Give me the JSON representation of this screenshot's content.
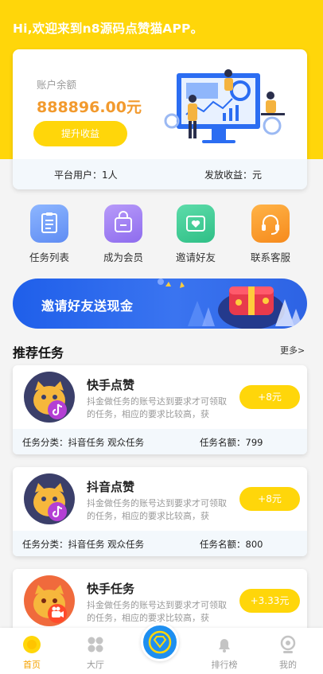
{
  "header": {
    "greeting": "Hi,欢迎来到n8源码点赞猫APP。"
  },
  "balance": {
    "label": "账户余额",
    "value": "888896.00元",
    "withdraw_label": "提升收益",
    "users_text": "平台用户：1人",
    "payout_text": "发放收益：元"
  },
  "menu": {
    "items": [
      {
        "label": "任务列表",
        "icon": "clipboard-icon",
        "color": "#6f98f7"
      },
      {
        "label": "成为会员",
        "icon": "member-bag-icon",
        "color": "#a07cf1"
      },
      {
        "label": "邀请好友",
        "icon": "envelope-heart-icon",
        "color": "#3dc895"
      },
      {
        "label": "联系客服",
        "icon": "headset-icon",
        "color": "#fb9a2a"
      }
    ]
  },
  "banner": {
    "text": "邀请好友送现金"
  },
  "recommend": {
    "title": "推荐任务",
    "more_label": "更多>"
  },
  "tasks": [
    {
      "name": "快手点赞",
      "desc": "抖金做任务的账号达到要求才可领取的任务，相应的要求比较高，获",
      "reward": "+8元",
      "category": "任务分类：抖音任务 观众任务",
      "quota": "任务名额：799",
      "avatar_bg": "#3b3f6a",
      "badge": "tiktok-icon"
    },
    {
      "name": "抖音点赞",
      "desc": "抖金做任务的账号达到要求才可领取的任务，相应的要求比较高，获",
      "reward": "+8元",
      "category": "任务分类：抖音任务 观众任务",
      "quota": "任务名额：800",
      "avatar_bg": "#3b3f6a",
      "badge": "tiktok-icon"
    },
    {
      "name": "快手任务",
      "desc": "抖金做任务的账号达到要求才可领取的任务，相应的要求比较高，获",
      "reward": "+3.33元",
      "category": "",
      "quota": "",
      "avatar_bg": "#f06a3c",
      "badge": "kuaishou-camera-icon"
    }
  ],
  "tabbar": {
    "items": [
      {
        "label": "首页",
        "icon": "home-icon",
        "active": true
      },
      {
        "label": "大厅",
        "icon": "grid-dots-icon",
        "active": false
      },
      {
        "label": "",
        "icon": "diamond-icon",
        "active": false
      },
      {
        "label": "排行榜",
        "icon": "bell-icon",
        "active": false
      },
      {
        "label": "我的",
        "icon": "profile-icon",
        "active": false
      }
    ]
  },
  "colors": {
    "brand_yellow": "#ffd60a",
    "balance_orange": "#f29a2e",
    "banner_blue": "#1f5fea",
    "tab_active": "#f5a200",
    "tab_inactive": "#999999"
  }
}
